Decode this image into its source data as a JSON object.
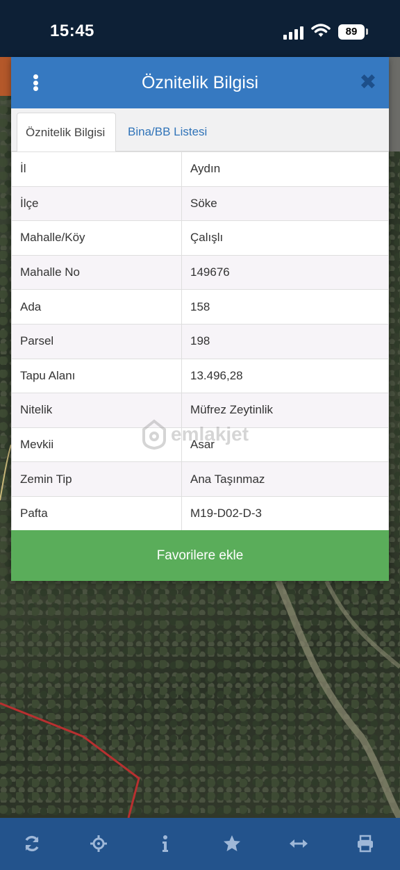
{
  "status_bar": {
    "time": "15:45",
    "battery": "89"
  },
  "dialog": {
    "title": "Öznitelik Bilgisi",
    "menu_icon": "vertical-dots-icon",
    "close_icon": "close-icon"
  },
  "tabs": [
    {
      "label": "Öznitelik Bilgisi",
      "active": true
    },
    {
      "label": "Bina/BB Listesi",
      "active": false
    }
  ],
  "attributes": [
    {
      "key": "İl",
      "value": "Aydın"
    },
    {
      "key": "İlçe",
      "value": "Söke"
    },
    {
      "key": "Mahalle/Köy",
      "value": "Çalışlı"
    },
    {
      "key": "Mahalle No",
      "value": "149676"
    },
    {
      "key": "Ada",
      "value": "158"
    },
    {
      "key": "Parsel",
      "value": "198"
    },
    {
      "key": "Tapu Alanı",
      "value": "13.496,28"
    },
    {
      "key": "Nitelik",
      "value": "Müfrez Zeytinlik"
    },
    {
      "key": "Mevkii",
      "value": "Asar"
    },
    {
      "key": "Zemin Tip",
      "value": "Ana Taşınmaz"
    },
    {
      "key": "Pafta",
      "value": "M19-D02-D-3"
    }
  ],
  "favorite_button": "Favorilere ekle",
  "watermark": "emlakjet",
  "toolbar": [
    {
      "icon": "refresh-icon"
    },
    {
      "icon": "crosshair-icon"
    },
    {
      "icon": "info-icon"
    },
    {
      "icon": "star-icon"
    },
    {
      "icon": "measure-arrows-icon"
    },
    {
      "icon": "print-icon"
    }
  ],
  "colors": {
    "header": "#3679c1",
    "status_bar": "#0d2036",
    "favorite_button": "#5aad5a",
    "bottom_bar": "#23538c",
    "tab_link": "#2f73b8"
  }
}
